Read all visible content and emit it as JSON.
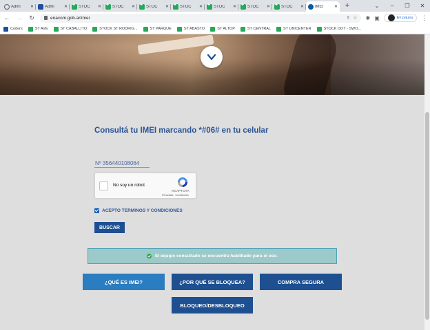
{
  "browser": {
    "tabs": [
      {
        "label": "Admi",
        "icon": "globe-icon",
        "active": false
      },
      {
        "label": "Admi",
        "icon": "blue-logo-icon",
        "active": false
      },
      {
        "label": "STOC",
        "icon": "green-plus-icon",
        "active": false
      },
      {
        "label": "STOC",
        "icon": "green-plus-icon",
        "active": false
      },
      {
        "label": "STOC",
        "icon": "green-plus-icon",
        "active": false
      },
      {
        "label": "STOC",
        "icon": "green-plus-icon",
        "active": false
      },
      {
        "label": "STOC",
        "icon": "green-plus-icon",
        "active": false
      },
      {
        "label": "STOC",
        "icon": "green-plus-icon",
        "active": false
      },
      {
        "label": "STOC",
        "icon": "green-plus-icon",
        "active": false
      },
      {
        "label": "IMEI",
        "icon": "enacom-icon",
        "active": true
      }
    ],
    "url": "enacom.gob.ar/imei",
    "profile_status": "En pausa",
    "bookmarks": [
      {
        "label": "Coders",
        "icon": "blue-logo-icon"
      },
      {
        "label": "ST AVE",
        "icon": "green-plus-icon"
      },
      {
        "label": "ST CABALLITO",
        "icon": "green-plus-icon"
      },
      {
        "label": "STOCK ST RODRIG...",
        "icon": "green-plus-icon"
      },
      {
        "label": "ST PARQUE",
        "icon": "green-plus-icon"
      },
      {
        "label": "ST ABASTO",
        "icon": "green-plus-icon"
      },
      {
        "label": "ST ALTOP",
        "icon": "green-plus-icon"
      },
      {
        "label": "ST CENTRAL",
        "icon": "green-plus-icon"
      },
      {
        "label": "ST UNICENTER",
        "icon": "green-plus-icon"
      },
      {
        "label": "STOCK DOT - SWO...",
        "icon": "green-plus-icon"
      }
    ]
  },
  "page": {
    "title": "Consultá tu IMEI marcando *#06# en tu celular",
    "imei_value": "Nº 356440108064",
    "captcha": {
      "label": "No soy un robot",
      "brand": "reCAPTCHA",
      "links": "Privacidad - Condiciones"
    },
    "terms_label": "ACEPTO TERMINOS Y CONDICIONES",
    "search_button": "BUSCAR",
    "result_message": "El equipo consultado se encuentra habilitado para el uso.",
    "buttons": {
      "que_es_imei": "¿QUÉ ES IMEI?",
      "por_que_bloquea": "¿POR QUÉ SE BLOQUEA?",
      "compra_segura": "COMPRA SEGURA",
      "bloqueo": "BLOQUEO/DESBLOQUEO"
    }
  },
  "colors": {
    "primary": "#1d4f91",
    "accent": "#2a7dc1",
    "title": "#2b5596",
    "success_bg": "#9cc9c9",
    "success_icon": "#28a745"
  }
}
